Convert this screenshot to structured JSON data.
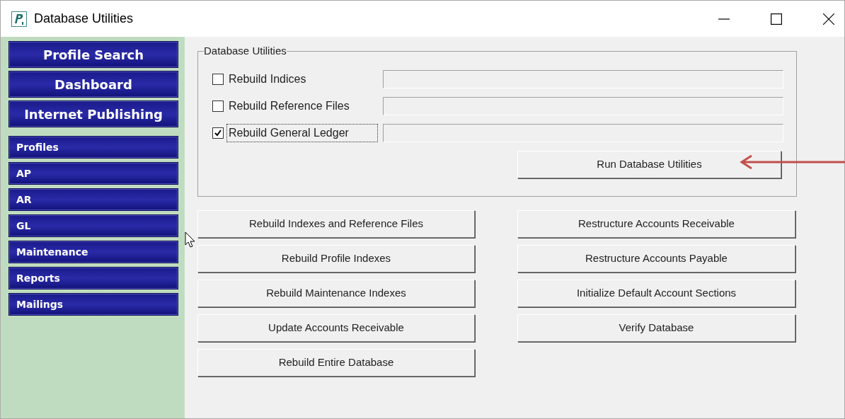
{
  "window": {
    "title": "Database Utilities"
  },
  "sidebar": {
    "primary": [
      "Profile Search",
      "Dashboard",
      "Internet Publishing"
    ],
    "items": [
      "Profiles",
      "AP",
      "AR",
      "GL",
      "Maintenance",
      "Reports",
      "Mailings"
    ]
  },
  "group": {
    "title": "Database Utilities",
    "options": [
      {
        "label": "Rebuild Indices",
        "checked": false,
        "focused": false
      },
      {
        "label": "Rebuild Reference Files",
        "checked": false,
        "focused": false
      },
      {
        "label": "Rebuild General Ledger",
        "checked": true,
        "focused": true
      }
    ],
    "run_button": "Run Database Utilities"
  },
  "buttons_left": [
    "Rebuild Indexes and Reference Files",
    "Rebuild Profile Indexes",
    "Rebuild Maintenance Indexes",
    "Update Accounts Receivable",
    "Rebuild Entire Database"
  ],
  "buttons_right": [
    "Restructure Accounts Receivable",
    "Restructure Accounts Payable",
    "Initialize Default Account Sections",
    "Verify Database"
  ]
}
